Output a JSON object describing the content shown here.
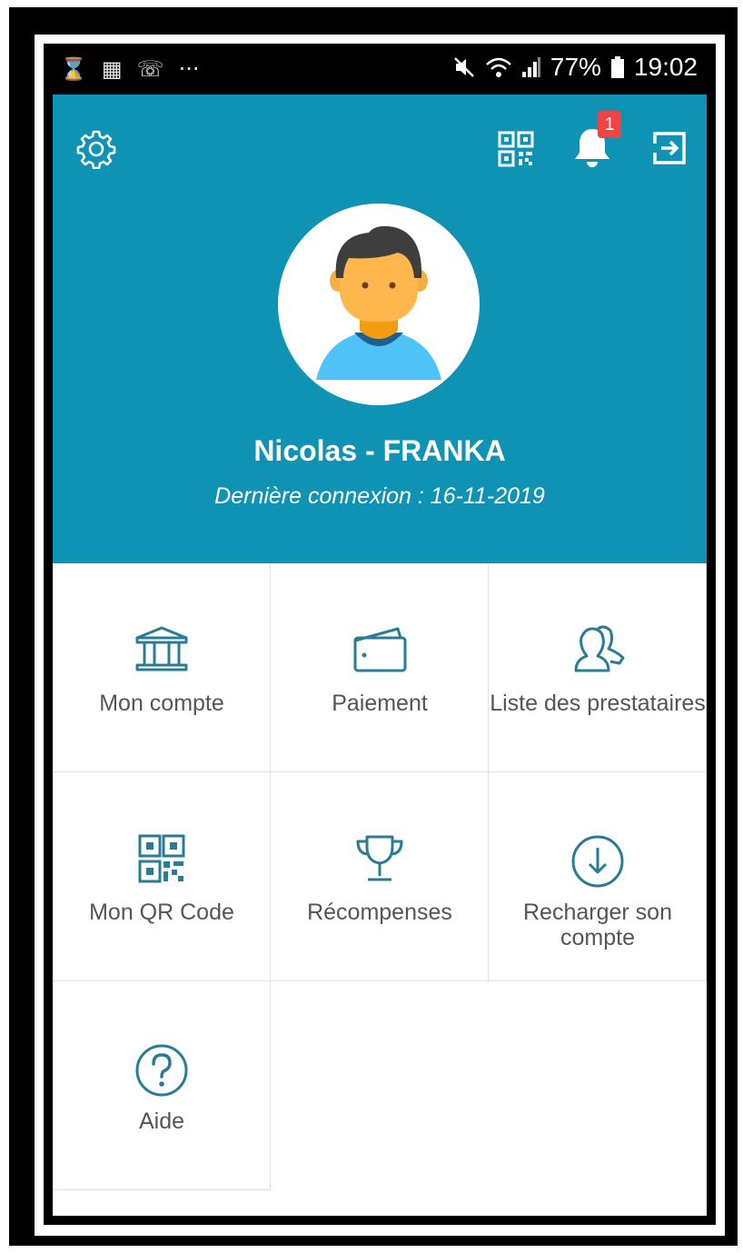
{
  "status_bar": {
    "battery": "77%",
    "time": "19:02"
  },
  "header": {
    "notification_count": "1",
    "user_name": "Nicolas - FRANKA",
    "last_login": "Dernière connexion : 16-11-2019"
  },
  "menu": {
    "items": [
      {
        "label": "Mon compte",
        "icon": "bank-icon"
      },
      {
        "label": "Paiement",
        "icon": "wallet-icon"
      },
      {
        "label": "Liste des prestataires",
        "icon": "users-icon"
      },
      {
        "label": "Mon QR Code",
        "icon": "qr-code-icon"
      },
      {
        "label": "Récompenses",
        "icon": "trophy-icon"
      },
      {
        "label": "Recharger son compte",
        "icon": "download-circle-icon"
      },
      {
        "label": "Aide",
        "icon": "help-icon"
      }
    ]
  },
  "colors": {
    "primary": "#0f93b4",
    "icon": "#2a7c94",
    "badge": "#f04444"
  }
}
